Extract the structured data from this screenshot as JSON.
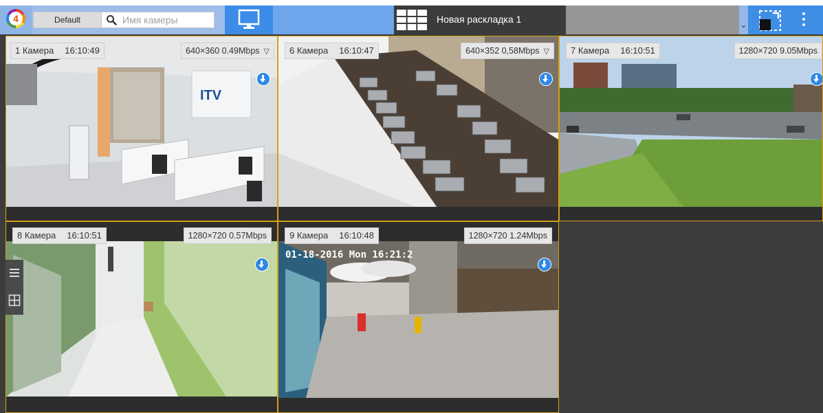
{
  "toolbar": {
    "logo_text": "4",
    "default_button": "Default",
    "search_placeholder": "Имя камеры",
    "layout_name": "Новая раскладка 1",
    "expand_arrow": "⌄"
  },
  "cameras": [
    {
      "name": "1 Камера",
      "time": "16:10:49",
      "stats": "640×360 0.49Mbps",
      "has_menu": true
    },
    {
      "name": "6 Камера",
      "time": "16:10:47",
      "stats": "640×352 0,58Mbps",
      "has_menu": true
    },
    {
      "name": "7 Камера",
      "time": "16:10:51",
      "stats": "1280×720 9.05Mbps",
      "has_menu": false
    },
    {
      "name": "8 Камера",
      "time": "16:10:51",
      "stats": "1280×720 0.57Mbps",
      "has_menu": false
    },
    {
      "name": "9 Камера",
      "time": "16:10:48",
      "stats": "1280×720 1.24Mbps",
      "has_menu": false
    }
  ],
  "overlays": {
    "cam9_osd": "01-18-2016 Mon 16:21:2",
    "cam1_logo": "ITV"
  },
  "icons": {
    "stats_menu": "▽"
  },
  "colors": {
    "cell_border": "#d4a017",
    "accent_blue": "#3d8de8",
    "download_blue": "#2f88e6"
  }
}
